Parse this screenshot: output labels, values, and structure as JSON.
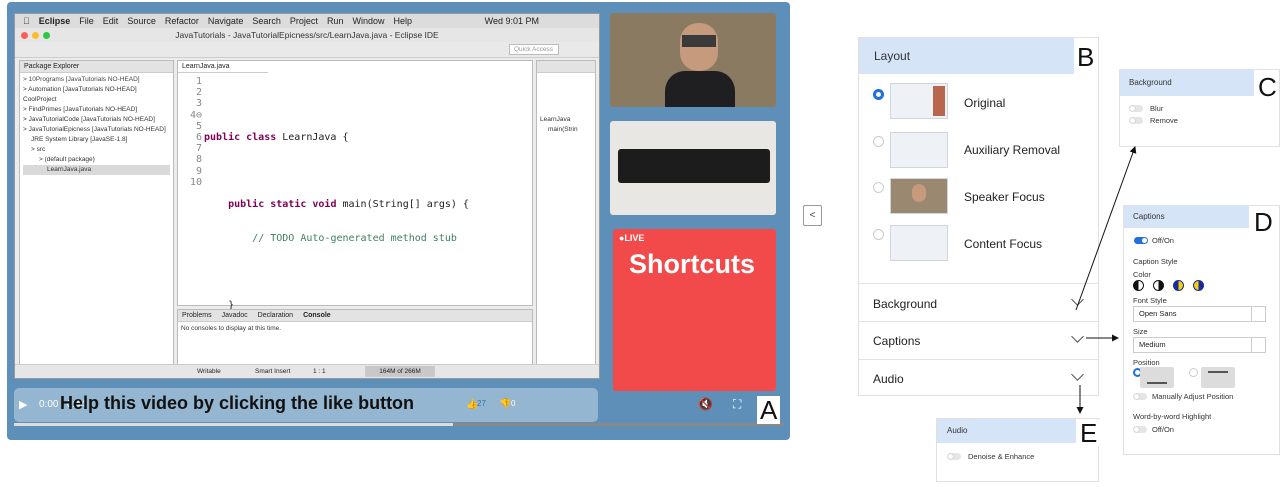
{
  "player": {
    "time": "0:00 / 0:44",
    "caption_text": "Help this video by clicking the like button",
    "like_count": "27",
    "dislike_count": "0",
    "progress": 0.57,
    "label": "A"
  },
  "ide": {
    "menu": [
      "Eclipse",
      "File",
      "Edit",
      "Source",
      "Refactor",
      "Navigate",
      "Search",
      "Project",
      "Run",
      "Window",
      "Help"
    ],
    "clock": "Wed 9:01 PM",
    "window_title": "JavaTutorials - JavaTutorialEpicness/src/LearnJava.java - Eclipse IDE",
    "quick_access": "Quick Access",
    "package_explorer_title": "Package Explorer",
    "tree": [
      "> 10Programs [JavaTutorials NO-HEAD]",
      "> Automation [JavaTutorials NO-HEAD]",
      "CoolProject",
      "> FindPrimes [JavaTutorials NO-HEAD]",
      "> JavaTutorialCode [JavaTutorials NO-HEAD]",
      "> JavaTutorialEpicness [JavaTutorials NO-HEAD]",
      "JRE System Library [JavaSE-1.8]",
      "> src",
      "> (default package)",
      "LearnJava.java"
    ],
    "editor_tab": "LearnJava.java",
    "line_numbers": [
      "1",
      "2",
      "3",
      "4⊖",
      "5",
      "6",
      "7",
      "8",
      "9",
      "10"
    ],
    "code": {
      "l2_kw": "public class",
      "l2_rest": " LearnJava {",
      "l4_kw": "public static void",
      "l4_rest": " main(String[] args) {",
      "l5": "// TODO Auto-generated method stub",
      "l7": "}",
      "l9": "}"
    },
    "outline_items": [
      "LearnJava",
      "main(Strin"
    ],
    "console_tabs": [
      "Problems",
      "Javadoc",
      "Declaration",
      "Console"
    ],
    "console_msg": "No consoles to display at this time.",
    "status": [
      "Writable",
      "Smart Insert",
      "1 : 1"
    ],
    "heap": "164M of 266M"
  },
  "live_card": {
    "badge": "●LIVE",
    "title": "Shortcuts"
  },
  "collapse_button": "<",
  "layout_panel": {
    "label": "B",
    "header": "Layout",
    "options": [
      "Original",
      "Auxiliary Removal",
      "Speaker Focus",
      "Content Focus"
    ],
    "selected_index": 0,
    "sections": [
      "Background",
      "Captions",
      "Audio"
    ]
  },
  "background_panel": {
    "label": "C",
    "header": "Background",
    "toggles": [
      "Blur",
      "Remove"
    ]
  },
  "captions_panel": {
    "label": "D",
    "header": "Captions",
    "on_off": "Off/On",
    "caption_style": "Caption Style",
    "color": "Color",
    "font_style": "Font Style",
    "font_value": "Open Sans",
    "size": "Size",
    "size_value": "Medium",
    "position": "Position",
    "manual": "Manually Adjust Position",
    "wbw": "Word-by-word Highlight",
    "wbw_toggle": "Off/On"
  },
  "audio_panel": {
    "label": "E",
    "header": "Audio",
    "toggle": "Denoise & Enhance"
  },
  "colors": {
    "accent": "#1f6fe0",
    "panel_header": "#d6e4f8",
    "live_red": "#f24a4a",
    "player_bg": "#5d8fb8"
  }
}
